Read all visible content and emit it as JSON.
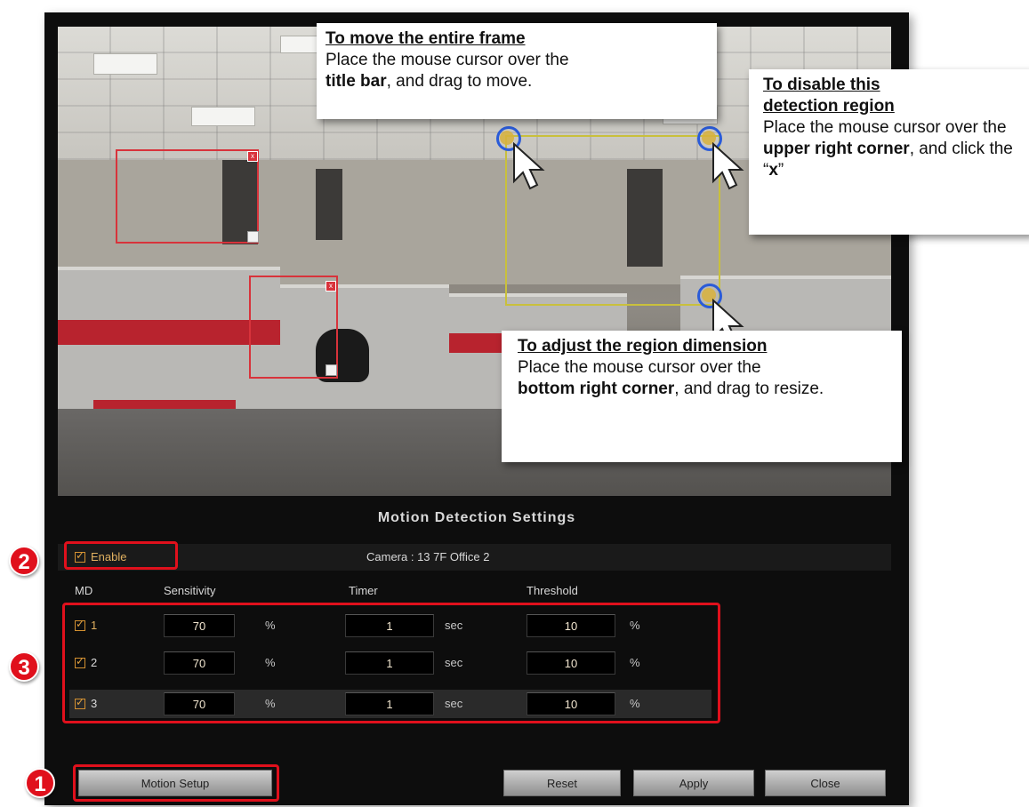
{
  "callouts": {
    "move": {
      "title": "To move the entire frame",
      "line1": "Place the mouse cursor over the",
      "bold": "title bar",
      "line2": ", and drag to move."
    },
    "disable": {
      "title": "To disable this detection region",
      "line1": "Place the mouse cursor over the",
      "bold1": "upper right corner",
      "line2": ", and click the “",
      "bold2": "x",
      "line3": "”"
    },
    "resize": {
      "title": "To adjust the region dimension",
      "line1": "Place the mouse cursor over the",
      "bold": "bottom right corner",
      "line2": ", and drag to resize."
    }
  },
  "settings": {
    "title": "Motion Detection Settings",
    "enable_label": "Enable",
    "camera_label": "Camera : 13 7F Office 2",
    "headers": {
      "md": "MD",
      "sensitivity": "Sensitivity",
      "timer": "Timer",
      "threshold": "Threshold"
    },
    "rows": [
      {
        "id": "1",
        "sensitivity": "70",
        "sens_unit": "%",
        "timer": "1",
        "timer_unit": "sec",
        "threshold": "10",
        "thr_unit": "%"
      },
      {
        "id": "2",
        "sensitivity": "70",
        "sens_unit": "%",
        "timer": "1",
        "timer_unit": "sec",
        "threshold": "10",
        "thr_unit": "%"
      },
      {
        "id": "3",
        "sensitivity": "70",
        "sens_unit": "%",
        "timer": "1",
        "timer_unit": "sec",
        "threshold": "10",
        "thr_unit": "%"
      }
    ]
  },
  "buttons": {
    "motion_setup": "Motion Setup",
    "reset": "Reset",
    "apply": "Apply",
    "close": "Close"
  },
  "badges": {
    "one": "1",
    "two": "2",
    "three": "3"
  },
  "colors": {
    "highlight": "#e0101c",
    "region_red": "#d8333b",
    "region_yellow": "#c9c03c",
    "cursor_ring": "#2a5bd8"
  }
}
